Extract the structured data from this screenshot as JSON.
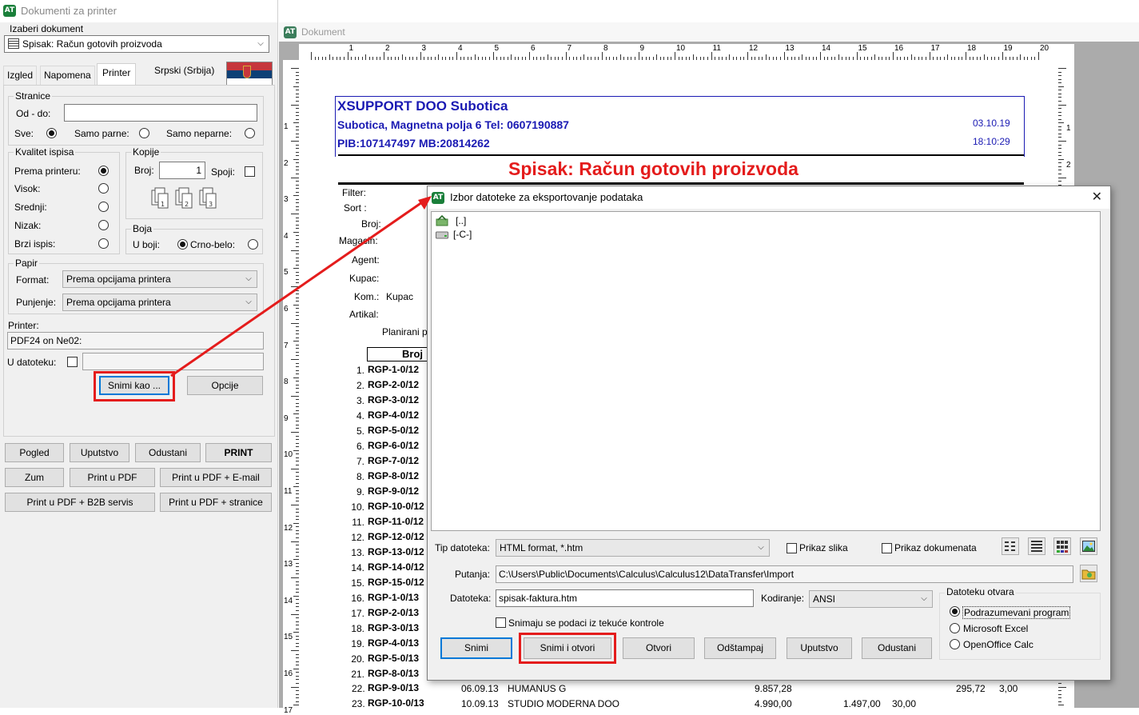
{
  "left_window": {
    "title": "Dokumenti za printer",
    "choose_doc_label": "Izaberi dokument",
    "selected_doc": "Spisak: Račun gotovih proizvoda",
    "tabs": [
      "Izgled",
      "Napomena",
      "Printer"
    ],
    "active_tab": "Printer",
    "language": "Srpski (Srbija)",
    "pages": {
      "title": "Stranice",
      "range_label": "Od - do:",
      "range_value": "",
      "all_label": "Sve:",
      "even_label": "Samo parne:",
      "odd_label": "Samo neparne:",
      "selected": "Sve"
    },
    "quality": {
      "title": "Kvalitet ispisa",
      "options": [
        "Prema printeru:",
        "Visok:",
        "Srednji:",
        "Nizak:",
        "Brzi ispis:"
      ],
      "selected": "Prema printeru:"
    },
    "copies": {
      "title": "Kopije",
      "count_label": "Broj:",
      "count_value": "1",
      "collate_label": "Spoji:",
      "collate_checked": false
    },
    "color": {
      "title": "Boja",
      "color_label": "U boji:",
      "bw_label": "Crno-belo:",
      "selected": "U boji"
    },
    "paper": {
      "title": "Papir",
      "format_label": "Format:",
      "format_value": "Prema opcijama printera",
      "feed_label": "Punjenje:",
      "feed_value": "Prema opcijama printera"
    },
    "printer_label": "Printer:",
    "printer_value": "PDF24 on Ne02:",
    "to_file_label": "U datoteku:",
    "to_file_checked": false,
    "to_file_value": "",
    "save_as_label": "Snimi kao ...",
    "options_label": "Opcije",
    "buttons_row1": [
      "Pogled",
      "Uputstvo",
      "Odustani",
      "PRINT"
    ],
    "buttons_row2": [
      "Zum",
      "Print u PDF",
      "Print u PDF + E-mail"
    ],
    "buttons_row3": [
      "Print u PDF + B2B servis",
      "Print u PDF + stranice"
    ]
  },
  "document_window": {
    "title": "Dokument",
    "ruler_numbers": [
      "1",
      "2",
      "3",
      "4",
      "5",
      "6",
      "7",
      "8",
      "9",
      "10",
      "11",
      "12",
      "13",
      "14",
      "15",
      "16",
      "17",
      "18",
      "19",
      "20"
    ],
    "ruler_side_numbers": [
      "1",
      "2",
      "3",
      "4",
      "5",
      "6",
      "7",
      "8",
      "9",
      "10",
      "11",
      "12",
      "13",
      "14",
      "15",
      "16",
      "17"
    ],
    "right_ruler_numbers": [
      "1",
      "2",
      "3"
    ],
    "company_name": "XSUPPORT DOO Subotica",
    "company_address": "Subotica, Magnetna polja 6 Tel: 0607190887",
    "company_ids": "PIB:107147497 MB:20814262",
    "date": "03.10.19",
    "time": "18:10:29",
    "report_title": "Spisak: Račun gotovih proizvoda",
    "filter_labels": [
      "Filter:",
      "Sort :",
      "Broj:",
      "Magacin:",
      "Agent:",
      "Kupac:",
      "Kom.:",
      "Artikal:"
    ],
    "kom_value": "Kupac",
    "planned_label": "Planirani p",
    "column_header": "Broj",
    "rows": [
      {
        "n": "1.",
        "id": "RGP-1-0/12"
      },
      {
        "n": "2.",
        "id": "RGP-2-0/12"
      },
      {
        "n": "3.",
        "id": "RGP-3-0/12"
      },
      {
        "n": "4.",
        "id": "RGP-4-0/12"
      },
      {
        "n": "5.",
        "id": "RGP-5-0/12"
      },
      {
        "n": "6.",
        "id": "RGP-6-0/12"
      },
      {
        "n": "7.",
        "id": "RGP-7-0/12"
      },
      {
        "n": "8.",
        "id": "RGP-8-0/12"
      },
      {
        "n": "9.",
        "id": "RGP-9-0/12"
      },
      {
        "n": "10.",
        "id": "RGP-10-0/12"
      },
      {
        "n": "11.",
        "id": "RGP-11-0/12"
      },
      {
        "n": "12.",
        "id": "RGP-12-0/12"
      },
      {
        "n": "13.",
        "id": "RGP-13-0/12"
      },
      {
        "n": "14.",
        "id": "RGP-14-0/12"
      },
      {
        "n": "15.",
        "id": "RGP-15-0/12"
      },
      {
        "n": "16.",
        "id": "RGP-1-0/13"
      },
      {
        "n": "17.",
        "id": "RGP-2-0/13"
      },
      {
        "n": "18.",
        "id": "RGP-3-0/13"
      },
      {
        "n": "19.",
        "id": "RGP-4-0/13"
      },
      {
        "n": "20.",
        "id": "RGP-5-0/13"
      },
      {
        "n": "21.",
        "id": "RGP-8-0/13"
      }
    ],
    "row22": {
      "n": "22.",
      "id": "RGP-9-0/13",
      "date": "06.09.13",
      "customer": "HUMANUS G",
      "amount": "9.857,28",
      "amount2": "295,72",
      "pct": "3,00"
    },
    "row23": {
      "n": "23.",
      "id": "RGP-10-0/13",
      "date": "10.09.13",
      "customer": "STUDIO MODERNA DOO",
      "amount": "4.990,00",
      "amount2": "1.497,00",
      "pct": "30,00"
    }
  },
  "dialog": {
    "title": "Izbor datoteke za eksportovanje podataka",
    "close": "✕",
    "items": [
      "[..]",
      "[-C-]"
    ],
    "file_type_label": "Tip datoteka:",
    "file_type_value": "HTML format, *.htm",
    "show_images_label": "Prikaz slika",
    "show_docs_label": "Prikaz dokumenata",
    "path_label": "Putanja:",
    "path_value": "C:\\Users\\Public\\Documents\\Calculus\\Calculus12\\DataTransfer\\Import",
    "file_label": "Datoteka:",
    "file_value": "spisak-faktura.htm",
    "encoding_label": "Kodiranje:",
    "encoding_value": "ANSI",
    "save_current_label": "Snimaju se podaci iz tekuće kontrole",
    "opens_title": "Datoteku otvara",
    "opens_options": [
      "Podrazumevani program",
      "Microsoft Excel",
      "OpenOffice Calc"
    ],
    "opens_selected": "Podrazumevani program",
    "buttons": [
      "Snimi",
      "Snimi i otvori",
      "Otvori",
      "Odštampaj",
      "Uputstvo",
      "Odustani"
    ]
  },
  "colors": {
    "highlight": "#e41c1c",
    "company_blue": "#1a1ab3",
    "title_red": "#e41c1c"
  }
}
